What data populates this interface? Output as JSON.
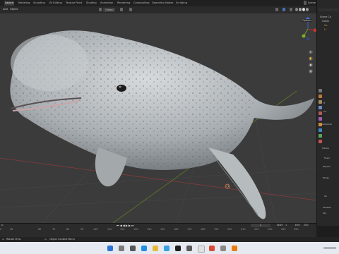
{
  "workspace_tabs": [
    "Layout",
    "Modeling",
    "Sculpting",
    "UV Editing",
    "Texture Paint",
    "Shading",
    "Animation",
    "Rendering",
    "Compositing",
    "Geometry Nodes",
    "Scripting"
  ],
  "active_tab": "Layout",
  "scene": {
    "label": "Scene"
  },
  "toolbar": {
    "view_mode": "Add",
    "object_menu": "Object",
    "transform": "Global",
    "options": "Options"
  },
  "outliner": {
    "title": "Scene Co",
    "items": [
      "Collec",
      "Ca",
      "Li"
    ]
  },
  "properties": {
    "labels": [
      "Tr",
      "Ch",
      "Amplitud",
      "Clamp",
      "Trunc",
      "Exposu",
      "Emiss",
      "Un",
      "Showse",
      "Sel"
    ]
  },
  "timeline": {
    "frames": [
      "0",
      "40",
      "60",
      "70",
      "80",
      "90",
      "100",
      "110",
      "120",
      "130",
      "140",
      "150",
      "160",
      "170",
      "180",
      "190",
      "200",
      "210",
      "220",
      "230",
      "240",
      "250"
    ],
    "current_frame": "1",
    "start_label": "Start",
    "start_value": "1",
    "end_label": "End",
    "end_value": "250"
  },
  "status": {
    "left": "Rotate View",
    "middle": "Object Context Menu"
  },
  "colors": {
    "accent": "#4772b3",
    "viewport": "#3b3b3b",
    "axis_x": "#c0392b",
    "axis_y": "#7fae2a",
    "axis_z": "#3e6fd6"
  }
}
